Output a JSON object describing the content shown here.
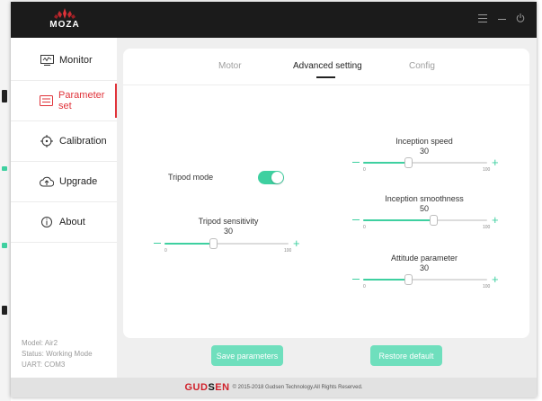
{
  "app": {
    "logo_text": "MOZA",
    "window_controls": [
      "menu-icon",
      "minimize-icon",
      "power-icon"
    ]
  },
  "sidebar": {
    "items": [
      {
        "label": "Monitor",
        "icon": "monitor-icon",
        "active": false
      },
      {
        "label": "Parameter set",
        "icon": "parameter-icon",
        "active": true
      },
      {
        "label": "Calibration",
        "icon": "calibration-icon",
        "active": false
      },
      {
        "label": "Upgrade",
        "icon": "upgrade-icon",
        "active": false
      },
      {
        "label": "About",
        "icon": "about-icon",
        "active": false
      }
    ],
    "status": {
      "model": "Model: Air2",
      "mode": "Status: Working Mode",
      "uart": "UART: COM3"
    }
  },
  "tabs": [
    "Motor",
    "Advanced setting",
    "Config"
  ],
  "active_tab": "Advanced setting",
  "settings": {
    "tripod_mode": {
      "label": "Tripod mode",
      "on": true
    },
    "tripod_sensitivity": {
      "label": "Tripod sensitivity",
      "value": "30",
      "min": "0",
      "max": "100"
    },
    "inception_speed": {
      "label": "Inception speed",
      "value": "30",
      "min": "0",
      "max": "100"
    },
    "inception_smoothness": {
      "label": "Inception smoothness",
      "value": "50",
      "min": "0",
      "max": "100"
    },
    "attitude_parameter": {
      "label": "Attitude parameter",
      "value": "30",
      "min": "0",
      "max": "100"
    }
  },
  "buttons": {
    "save": "Save parameters",
    "restore": "Restore default"
  },
  "footer": {
    "brand_red_1": "GUD",
    "brand_dark": "S",
    "brand_red_2": "EN",
    "copyright": "© 2015-2018 Gudsen Technology.All Rights Reserved."
  },
  "colors": {
    "accent": "#3ed0a0",
    "active_nav": "#e0333a",
    "titlebar": "#1b1b1b"
  }
}
